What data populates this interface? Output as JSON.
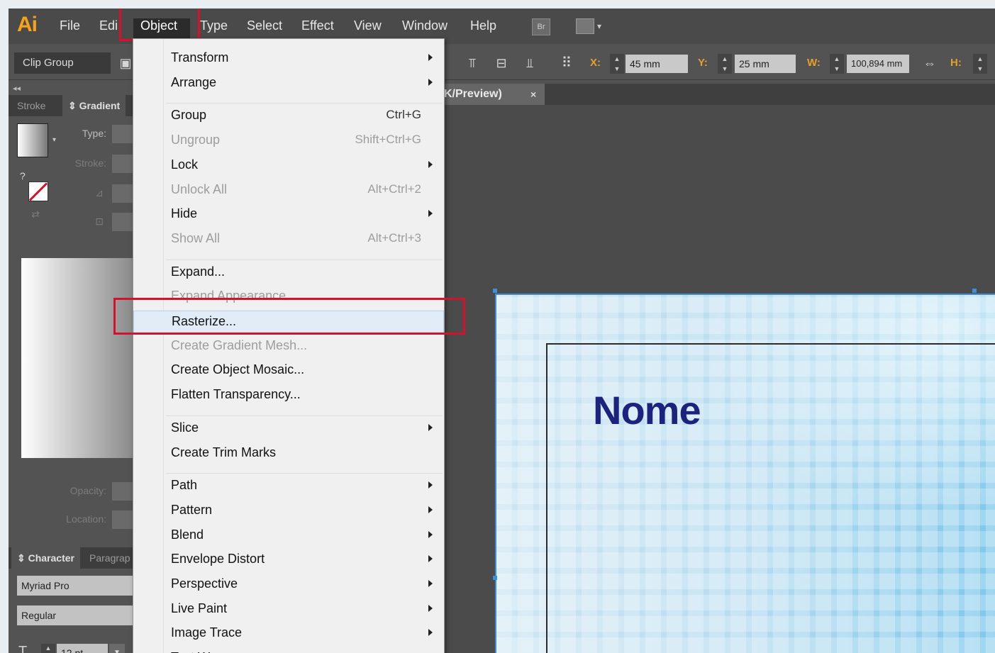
{
  "app": {
    "logo": "Ai",
    "br_label": "Br"
  },
  "menubar": {
    "items": [
      "File",
      "Edi",
      "Object",
      "Type",
      "Select",
      "Effect",
      "View",
      "Window",
      "Help"
    ],
    "active": "Object"
  },
  "controlbar": {
    "selection_label": "Clip Group",
    "x_label": "X:",
    "x_value": "45 mm",
    "y_label": "Y:",
    "y_value": "25 mm",
    "w_label": "W:",
    "w_value": "100,894 mm",
    "h_label": "H:"
  },
  "gradient_panel": {
    "tabs": [
      "Stroke",
      "Gradient"
    ],
    "active_tab": "Gradient",
    "type_label": "Type:",
    "stroke_label": "Stroke:",
    "opacity_label": "Opacity:",
    "location_label": "Location:",
    "question_mark": "?"
  },
  "character_panel": {
    "tabs": [
      "Character",
      "Paragrap"
    ],
    "font_family": "Myriad Pro",
    "font_style": "Regular",
    "font_size": "12 pt"
  },
  "document": {
    "tab_title": "K/Preview)",
    "close_glyph": "×",
    "artboard_text": "Nome"
  },
  "object_menu": {
    "items": [
      {
        "label": "Transform",
        "submenu": true
      },
      {
        "label": "Arrange",
        "submenu": true
      },
      {
        "separator": true
      },
      {
        "label": "Group",
        "shortcut": "Ctrl+G"
      },
      {
        "label": "Ungroup",
        "shortcut": "Shift+Ctrl+G",
        "disabled": true
      },
      {
        "label": "Lock",
        "submenu": true
      },
      {
        "label": "Unlock All",
        "shortcut": "Alt+Ctrl+2",
        "disabled": true
      },
      {
        "label": "Hide",
        "submenu": true
      },
      {
        "label": "Show All",
        "shortcut": "Alt+Ctrl+3",
        "disabled": true
      },
      {
        "separator": true
      },
      {
        "label": "Expand..."
      },
      {
        "label": "Expand Appearance",
        "disabled": true
      },
      {
        "label": "Rasterize...",
        "highlighted": true
      },
      {
        "label": "Create Gradient Mesh...",
        "disabled": true
      },
      {
        "label": "Create Object Mosaic..."
      },
      {
        "label": "Flatten Transparency..."
      },
      {
        "separator": true
      },
      {
        "label": "Slice",
        "submenu": true
      },
      {
        "label": "Create Trim Marks"
      },
      {
        "separator": true
      },
      {
        "label": "Path",
        "submenu": true
      },
      {
        "label": "Pattern",
        "submenu": true
      },
      {
        "label": "Blend",
        "submenu": true
      },
      {
        "label": "Envelope Distort",
        "submenu": true
      },
      {
        "label": "Perspective",
        "submenu": true
      },
      {
        "label": "Live Paint",
        "submenu": true
      },
      {
        "label": "Image Trace",
        "submenu": true
      },
      {
        "label": "Text Wrap",
        "submenu": true
      }
    ]
  },
  "colors": {
    "accent_red": "#d6112a",
    "logo_orange": "#f7a21b",
    "selection_blue": "#3e8fd6"
  }
}
